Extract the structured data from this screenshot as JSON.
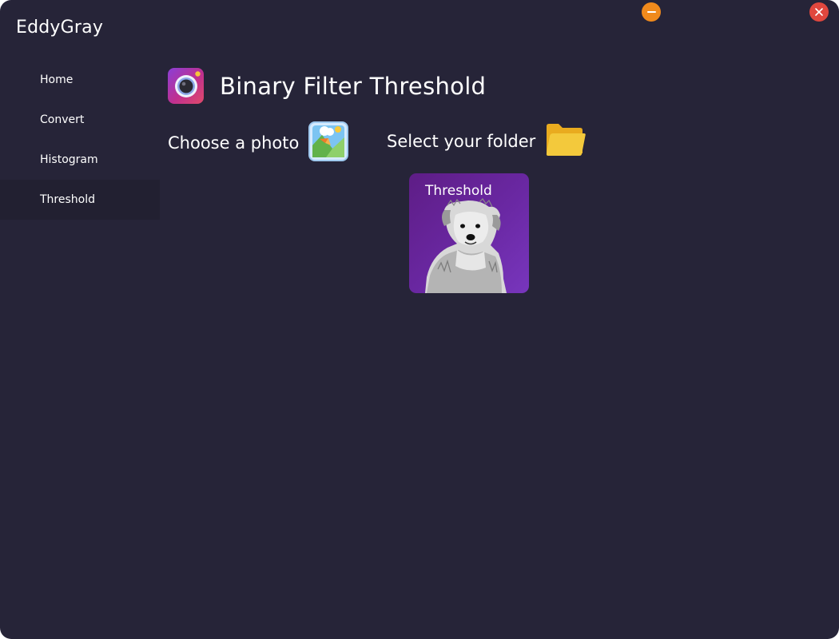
{
  "app": {
    "title": "EddyGray"
  },
  "window_controls": {
    "minimize_color": "#f08a1c",
    "close_color": "#e0473e",
    "minimize_icon": "minus-icon",
    "close_icon": "x-icon"
  },
  "sidebar": {
    "items": [
      {
        "label": "Home",
        "active": false
      },
      {
        "label": "Convert",
        "active": false
      },
      {
        "label": "Histogram",
        "active": false
      },
      {
        "label": "Threshold",
        "active": true
      }
    ]
  },
  "main": {
    "title": "Binary Filter Threshold",
    "title_icon": "camera-icon",
    "choose_photo": {
      "label": "Choose a photo",
      "icon": "image-picture-icon"
    },
    "select_folder": {
      "label": "Select your folder",
      "icon": "folder-icon"
    },
    "preview": {
      "label": "Threshold",
      "image": "dog-photo"
    }
  },
  "colors": {
    "background": "#262438",
    "sidebar_active": "#222031",
    "card_purple": "#6a28a3",
    "folder_yellow": "#f3c436"
  }
}
